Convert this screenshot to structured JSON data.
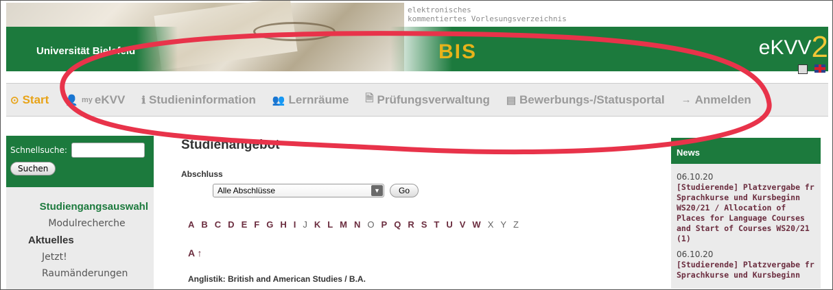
{
  "header": {
    "university": "Universität Bielefeld",
    "subtitle_line1": "elektronisches",
    "subtitle_line2": "kommentiertes Vorlesungsverzeichnis",
    "bis_logo": "BIS",
    "ekvv_logo": "eKVV",
    "ekvv_version": "2"
  },
  "nav": {
    "items": [
      {
        "label": "Start",
        "icon": "clock-icon",
        "glyph": "⊙",
        "active": true
      },
      {
        "label": "eKVV",
        "icon": "user-icon",
        "glyph": "👤",
        "sup": "my"
      },
      {
        "label": "Studieninformation",
        "icon": "info-icon",
        "glyph": "ℹ"
      },
      {
        "label": "Lernräume",
        "icon": "group-icon",
        "glyph": "👥"
      },
      {
        "label": "Prüfungsverwaltung",
        "icon": "document-icon",
        "glyph": "🗎"
      },
      {
        "label": "Bewerbungs-/Statusportal",
        "icon": "card-icon",
        "glyph": "▤"
      },
      {
        "label": "Anmelden",
        "icon": "login-icon",
        "glyph": "→"
      }
    ]
  },
  "sidebar": {
    "search_label": "Schnellsuche:",
    "search_value": "",
    "search_button": "Suchen",
    "active_item": "Studiengangsauswahl",
    "item_modul": "Modulrecherche",
    "section_aktuelles": "Aktuelles",
    "item_jetzt": "Jetzt!",
    "item_raum": "Raumänderungen"
  },
  "main": {
    "title": "Studienangebot",
    "abschluss_label": "Abschluss",
    "select_value": "Alle Abschlüsse",
    "go_button": "Go",
    "letters_active": [
      "A",
      "B",
      "C",
      "D",
      "E",
      "F",
      "G",
      "H",
      "I"
    ],
    "letters_inactive_1": [
      "J"
    ],
    "letters_active_2": [
      "K",
      "L",
      "M",
      "N"
    ],
    "letters_inactive_2": [
      "O"
    ],
    "letters_active_3": [
      "P",
      "Q",
      "R",
      "S",
      "T",
      "U",
      "V",
      "W"
    ],
    "letters_inactive_3": [
      "X",
      "Y",
      "Z"
    ],
    "section_letter": "A",
    "first_entry": "Anglistik: British and American Studies / B.A."
  },
  "news": {
    "title": "News",
    "entries": [
      {
        "date": "06.10.20",
        "title": "[Studierende] Platzvergabe fr Sprachkurse und Kursbeginn WS20/21 / Allocation of Places for Language Courses and Start of Courses WS20/21 (1)"
      },
      {
        "date": "06.10.20",
        "title": "[Studierende] Platzvergabe fr Sprachkurse und Kursbeginn"
      }
    ]
  },
  "colors": {
    "brand_green": "#1c7a3d",
    "accent_orange": "#e8a317",
    "link_maroon": "#6b2d3f",
    "annotation_red": "#e8334a"
  }
}
